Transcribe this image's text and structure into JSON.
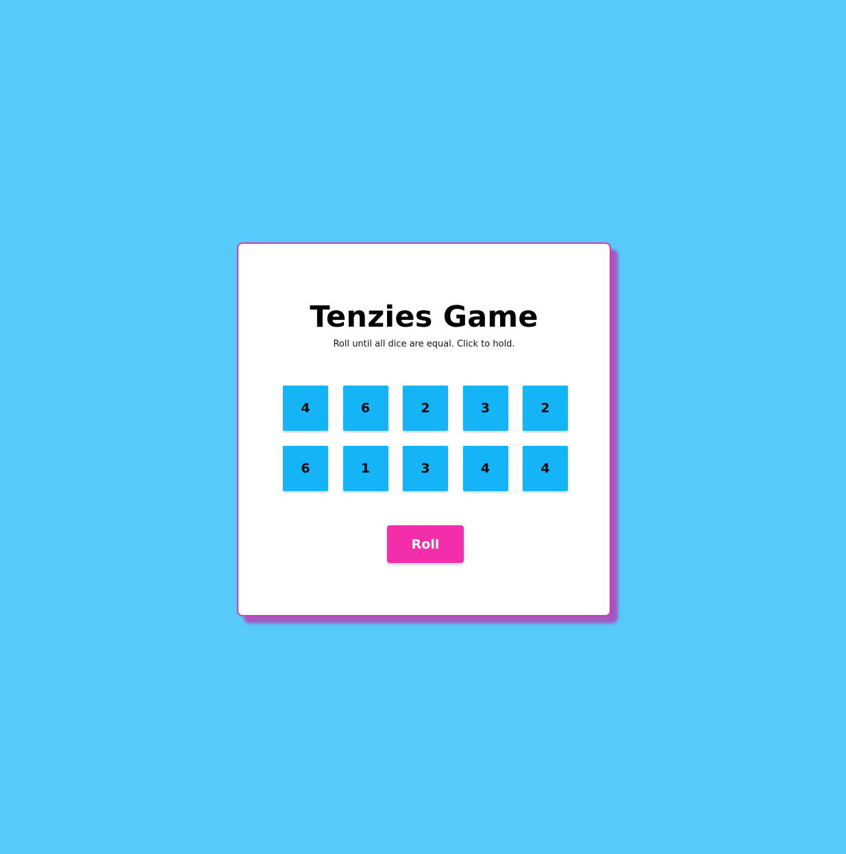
{
  "colors": {
    "background": "#57caf9",
    "card": "#ffffff",
    "accent": "#f22eab",
    "die": "#14b4f6"
  },
  "game": {
    "title": "Tenzies Game",
    "subtitle": "Roll until all dice are equal. Click to hold.",
    "dice": [
      4,
      6,
      2,
      3,
      2,
      6,
      1,
      3,
      4,
      4
    ],
    "roll_label": "Roll"
  }
}
